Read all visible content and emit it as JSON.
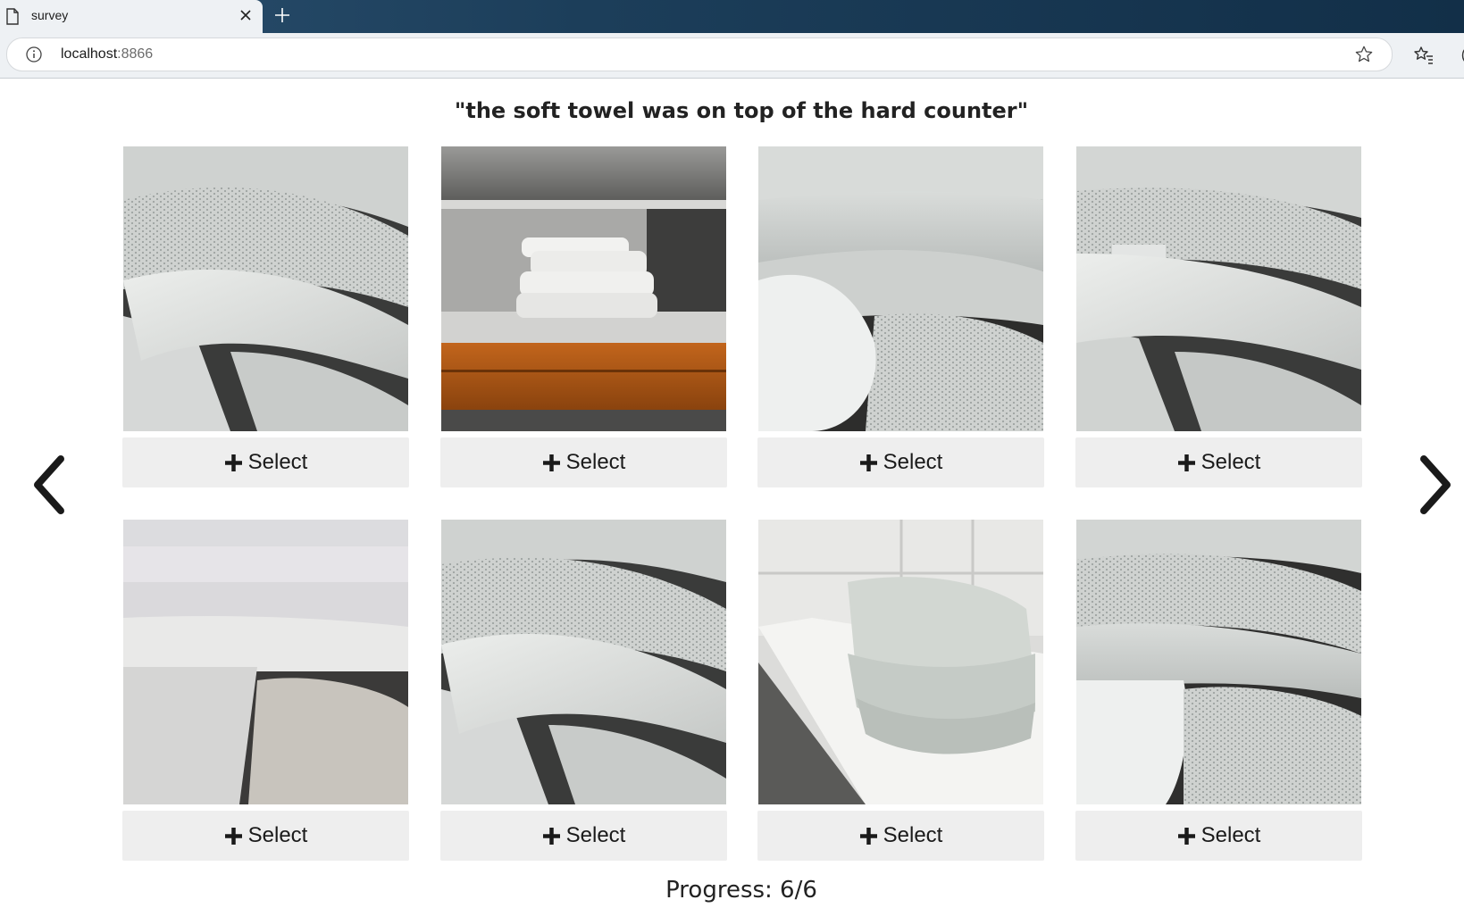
{
  "browser": {
    "tab_title": "survey",
    "url_host": "localhost",
    "url_port": ":8866"
  },
  "prompt": "\"the soft towel was on top of the hard counter\"",
  "cards": [
    {
      "select_label": "Select"
    },
    {
      "select_label": "Select"
    },
    {
      "select_label": "Select"
    },
    {
      "select_label": "Select"
    },
    {
      "select_label": "Select"
    },
    {
      "select_label": "Select"
    },
    {
      "select_label": "Select"
    },
    {
      "select_label": "Select"
    }
  ],
  "progress": "Progress: 6/6",
  "icons": [
    "page-icon",
    "close-icon",
    "plus-icon",
    "info-icon",
    "star-icon",
    "favorites-icon",
    "chevron-left-icon",
    "chevron-right-icon"
  ],
  "colors": {
    "tab_bar": "#1c3e5a",
    "button_bg": "#eeeeee",
    "chrome_bg": "#eef1f4"
  }
}
